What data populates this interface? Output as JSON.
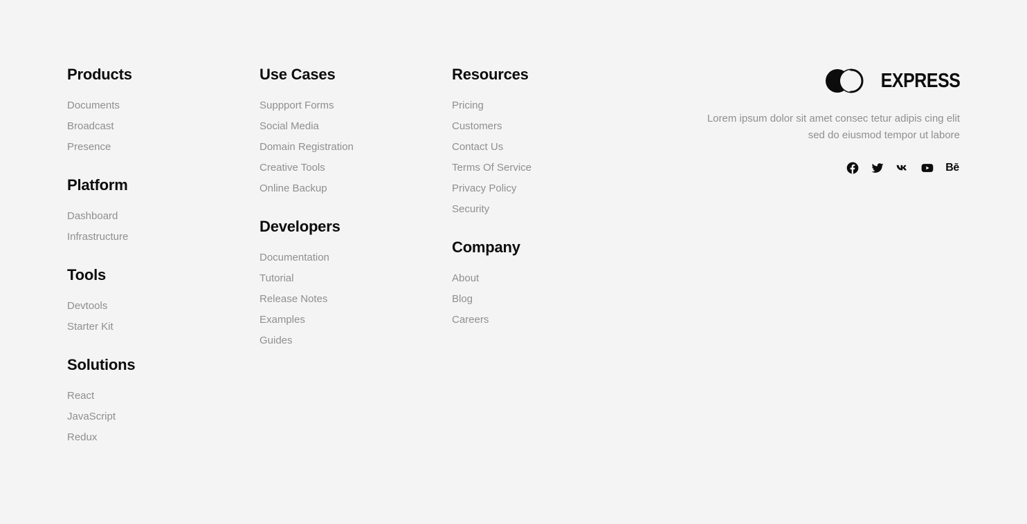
{
  "columns": [
    {
      "groups": [
        {
          "title": "Products",
          "links": [
            "Documents",
            "Broadcast",
            "Presence"
          ]
        },
        {
          "title": "Platform",
          "links": [
            "Dashboard",
            "Infrastructure"
          ]
        },
        {
          "title": "Tools",
          "links": [
            "Devtools",
            "Starter Kit"
          ]
        },
        {
          "title": "Solutions",
          "links": [
            "React",
            "JavaScript",
            "Redux"
          ]
        }
      ]
    },
    {
      "groups": [
        {
          "title": "Use Cases",
          "links": [
            "Suppport Forms",
            "Social Media",
            "Domain Registration",
            "Creative Tools",
            "Online Backup"
          ]
        },
        {
          "title": "Developers",
          "links": [
            "Documentation",
            "Tutorial",
            "Release Notes",
            "Examples",
            "Guides"
          ]
        }
      ]
    },
    {
      "groups": [
        {
          "title": "Resources",
          "links": [
            "Pricing",
            "Customers",
            "Contact Us",
            "Terms Of Service",
            "Privacy Policy",
            "Security"
          ]
        },
        {
          "title": "Company",
          "links": [
            "About",
            "Blog",
            "Careers"
          ]
        }
      ]
    }
  ],
  "brand": {
    "name": "EXPRESS",
    "description_line1": "Lorem ipsum dolor sit amet consec tetur adipis cing elit",
    "description_line2": "sed do eiusmod tempor ut labore"
  },
  "social": [
    {
      "icon": "facebook-icon"
    },
    {
      "icon": "twitter-icon"
    },
    {
      "icon": "vk-icon"
    },
    {
      "icon": "youtube-icon"
    },
    {
      "icon": "behance-icon",
      "label": "Bē"
    }
  ],
  "colors": {
    "background": "#f4f4f4",
    "heading": "#0c0c0c",
    "link": "#8f8f8f"
  }
}
